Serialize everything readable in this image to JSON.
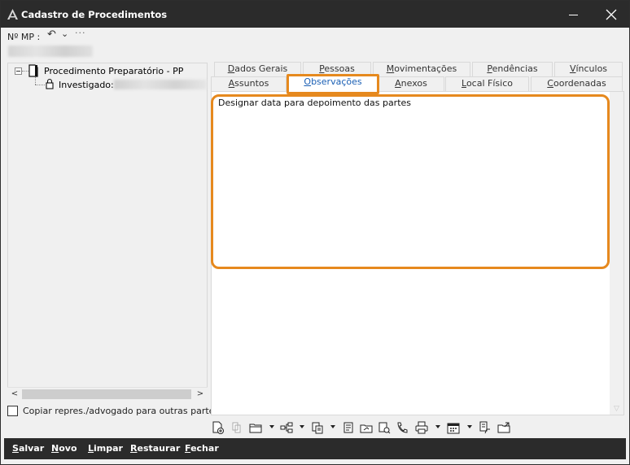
{
  "window": {
    "title": "Cadastro de Procedimentos",
    "minimize_icon": "minimize-icon",
    "close_icon": "close-icon"
  },
  "header": {
    "mp_label": "Nº MP :",
    "undo_icon": "undo-icon",
    "chevron_icon": "chevron-down-icon",
    "more_icon": "more-icon"
  },
  "tree": {
    "root_label": "Procedimento Preparatório - PP",
    "child_label": "Investigado:"
  },
  "left_footer": {
    "copy_label": "Copiar repres./advogado para outras partes",
    "copy_checked": false
  },
  "tabs": {
    "row1": [
      {
        "label": "Dados Gerais",
        "underline": "D",
        "rest": "ados Gerais"
      },
      {
        "label": "Pessoas",
        "underline": "P",
        "rest": "essoas"
      },
      {
        "label": "Movimentações",
        "underline": "M",
        "rest": "ovimentações"
      },
      {
        "label": "Pendências",
        "underline": "P",
        "rest": "endências"
      },
      {
        "label": "Vínculos",
        "underline": "V",
        "rest": "ínculos"
      }
    ],
    "row2": [
      {
        "label": "Assuntos",
        "underline": "A",
        "rest": "ssuntos"
      },
      {
        "label": "Observações",
        "underline": "O",
        "rest": "bservações"
      },
      {
        "label": "Anexos",
        "underline": "A",
        "rest": "nexos"
      },
      {
        "label": "Local Físico",
        "underline": "L",
        "rest": "ocal Físico"
      },
      {
        "label": "Coordenadas",
        "underline": "C",
        "rest": "oordenadas"
      }
    ],
    "active": "Observações"
  },
  "observacoes": {
    "text": "Designar data para depoimento das partes"
  },
  "toolbar": {
    "icons": [
      "add-document-icon",
      "copy-document-icon",
      "folder-icon",
      "tree-structure-icon",
      "import-icon",
      "report-icon",
      "folder-share-icon",
      "document-search-icon",
      "phone-icon",
      "print-icon",
      "calendar-icon",
      "edit-document-icon",
      "folder-export-icon"
    ]
  },
  "actions": {
    "salvar": {
      "label": "Salvar",
      "underline": "S",
      "rest": "alvar"
    },
    "novo": {
      "label": "Novo",
      "underline": "N",
      "rest": "ovo"
    },
    "limpar": {
      "label": "Limpar",
      "underline": "L",
      "rest": "impar"
    },
    "restaurar": {
      "label": "Restaurar",
      "underline": "R",
      "rest": "estaurar"
    },
    "fechar": {
      "label": "Fechar",
      "underline": "F",
      "rest": "echar"
    }
  },
  "colors": {
    "titlebar": "#2b2b2b",
    "highlight": "#e6891e",
    "active_tab_text": "#1a5fb4",
    "window_bg": "#f0f0f0"
  }
}
